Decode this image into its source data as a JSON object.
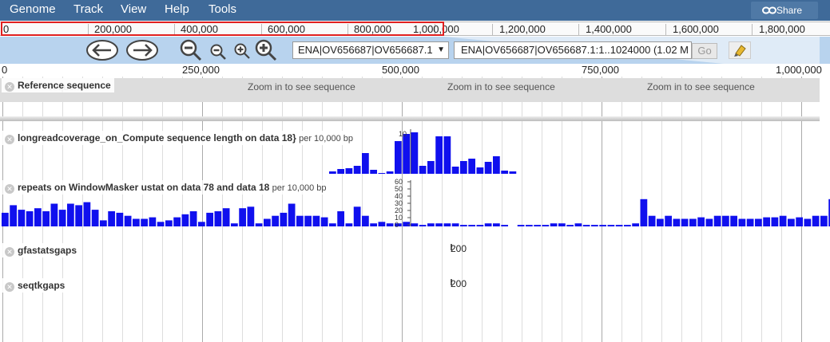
{
  "menu": {
    "items": [
      "Genome",
      "Track",
      "View",
      "Help",
      "Tools"
    ],
    "share_label": "Share"
  },
  "overview": {
    "labels": [
      "0",
      "200,000",
      "400,000",
      "600,000",
      "800,000",
      "1,000,000",
      "1,200,000",
      "1,400,000",
      "1,600,000",
      "1,800,000"
    ]
  },
  "nav": {
    "back_icon": "arrow-left-icon",
    "forward_icon": "arrow-right-icon",
    "zoom_icons": [
      "zoom-out-large-icon",
      "zoom-out-small-icon",
      "zoom-in-small-icon",
      "zoom-in-large-icon"
    ],
    "sequence_select": "ENA|OV656687|OV656687.1",
    "location_input": "ENA|OV656687|OV656687.1:1..1024000 (1.02 M",
    "go_label": "Go",
    "highlight_icon": "highlighter-icon"
  },
  "ruler": {
    "labels": [
      "0",
      "250,000",
      "500,000",
      "750,000",
      "1,000,000"
    ]
  },
  "tracks": {
    "refseq": {
      "label": "Reference sequence",
      "faded_text": "sequence",
      "zoom_message": "Zoom in to see sequence"
    },
    "coverage": {
      "label": "longreadcoverage_on_Compute sequence length on data 18}",
      "unit": "per 10,000 bp",
      "scale_ticks": [
        "10"
      ]
    },
    "repeats": {
      "label": "repeats on WindowMasker ustat on data 78 and data 18",
      "unit": "per 10,000 bp",
      "scale_ticks": [
        "60",
        "50",
        "40",
        "30",
        "20",
        "10",
        "0"
      ]
    },
    "gfastatsgaps": {
      "label": "gfastatsgaps",
      "gap_value": "200"
    },
    "seqtkgaps": {
      "label": "seqtkgaps",
      "gap_value": "200"
    }
  },
  "colors": {
    "menubar": "#3f6a99",
    "nav": "#b8d3ee",
    "bar": "#1010ee",
    "highlight": "#e02020"
  },
  "coverage_bars": [
    {
      "pos": 40,
      "v": 0.3
    },
    {
      "pos": 41,
      "v": 0.6
    },
    {
      "pos": 42,
      "v": 0.7
    },
    {
      "pos": 43,
      "v": 1.0
    },
    {
      "pos": 44,
      "v": 2.6
    },
    {
      "pos": 45,
      "v": 0.5
    },
    {
      "pos": 46,
      "v": 0.1
    },
    {
      "pos": 47,
      "v": 0.3
    },
    {
      "pos": 48,
      "v": 4.1
    },
    {
      "pos": 49,
      "v": 5.0
    },
    {
      "pos": 50,
      "v": 5.2
    },
    {
      "pos": 51,
      "v": 1.0
    },
    {
      "pos": 52,
      "v": 1.6
    },
    {
      "pos": 53,
      "v": 4.7
    },
    {
      "pos": 54,
      "v": 4.7
    },
    {
      "pos": 55,
      "v": 0.9
    },
    {
      "pos": 56,
      "v": 1.6
    },
    {
      "pos": 57,
      "v": 1.9
    },
    {
      "pos": 58,
      "v": 0.8
    },
    {
      "pos": 59,
      "v": 1.5
    },
    {
      "pos": 60,
      "v": 2.2
    },
    {
      "pos": 61,
      "v": 0.4
    },
    {
      "pos": 62,
      "v": 0.3
    }
  ],
  "repeats_bars": [
    18,
    28,
    22,
    20,
    24,
    20,
    30,
    22,
    30,
    28,
    32,
    22,
    8,
    20,
    18,
    14,
    10,
    10,
    12,
    6,
    8,
    12,
    16,
    20,
    6,
    18,
    20,
    24,
    4,
    24,
    26,
    4,
    10,
    14,
    18,
    30,
    14,
    14,
    14,
    12,
    4,
    20,
    4,
    26,
    14,
    4,
    6,
    4,
    4,
    6,
    4,
    2,
    4,
    4,
    4,
    4,
    2,
    2,
    2,
    4,
    4,
    2,
    0,
    2,
    2,
    2,
    2,
    4,
    4,
    2,
    4,
    2,
    2,
    2,
    2,
    2,
    2,
    4,
    36,
    14,
    10,
    14,
    10,
    10,
    10,
    12,
    10,
    14,
    14,
    14,
    10,
    10,
    10,
    12,
    12,
    14,
    10,
    12,
    10,
    14,
    14,
    36,
    56,
    20,
    18,
    14,
    14,
    12,
    16,
    16,
    16,
    12,
    16,
    12,
    14,
    12,
    18,
    4,
    22,
    26,
    24,
    22,
    6,
    16,
    4
  ]
}
